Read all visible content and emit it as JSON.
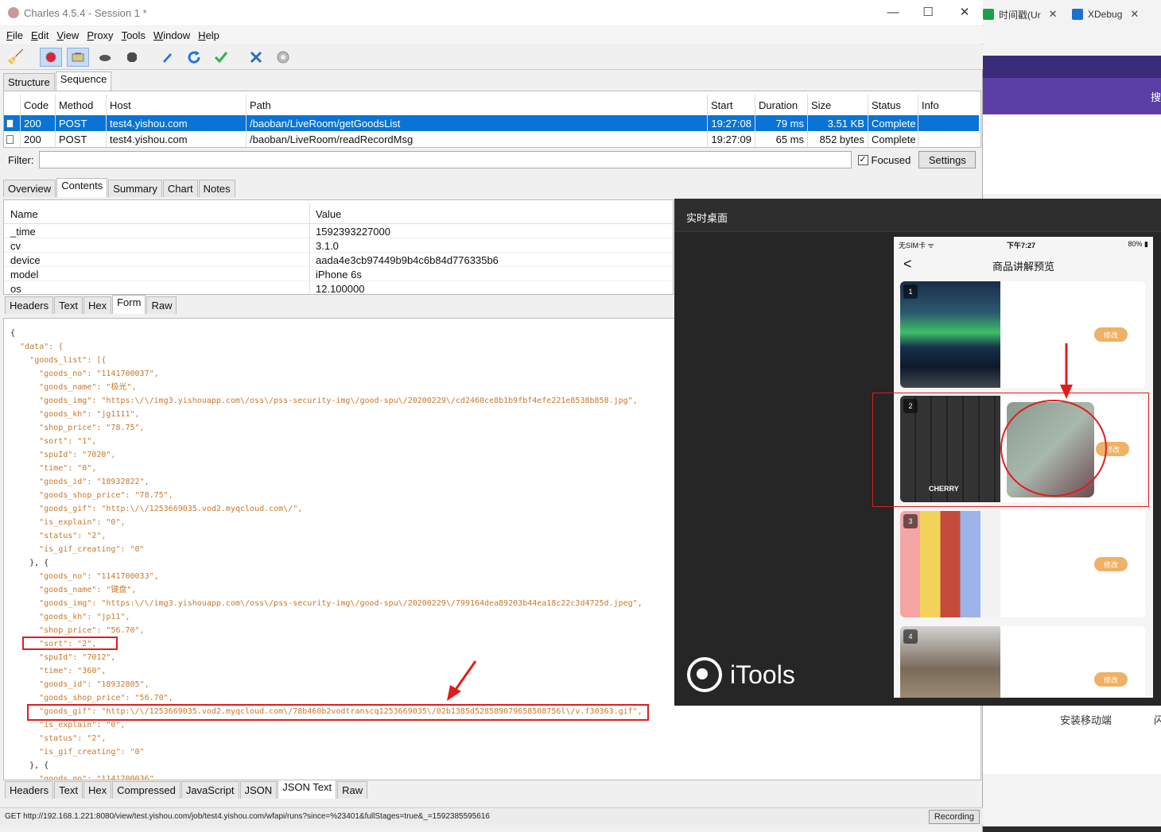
{
  "window": {
    "title": "Charles 4.5.4 - Session 1 *",
    "controls": [
      "—",
      "☐",
      "✕"
    ]
  },
  "browser_tabs": [
    {
      "label": "时间戳(Ur",
      "icon_color": "#1e9e4a"
    },
    {
      "label": "XDebug",
      "icon_color": "#1f6fd1"
    }
  ],
  "browser_bg": {
    "search_char": "搜",
    "install_label": "安装移动端",
    "more_char": "闪"
  },
  "menu": [
    "File",
    "Edit",
    "View",
    "Proxy",
    "Tools",
    "Window",
    "Help"
  ],
  "toolbar_icons": [
    "broom-icon",
    "record-icon",
    "throttle-icon",
    "turtle-icon",
    "stop-icon",
    "pen-icon",
    "refresh-icon",
    "check-icon",
    "tools-icon",
    "settings-icon"
  ],
  "top_tabs": [
    "Structure",
    "Sequence"
  ],
  "sequence": {
    "columns": [
      "Code",
      "Method",
      "Host",
      "Path",
      "Start",
      "Duration",
      "Size",
      "Status",
      "Info"
    ],
    "rows": [
      {
        "code": "200",
        "method": "POST",
        "host": "test4.yishou.com",
        "path": "/baoban/LiveRoom/getGoodsList",
        "start": "19:27:08",
        "duration": "79 ms",
        "size": "3.51 KB",
        "status": "Complete",
        "info": ""
      },
      {
        "code": "200",
        "method": "POST",
        "host": "test4.yishou.com",
        "path": "/baoban/LiveRoom/readRecordMsg",
        "start": "19:27:09",
        "duration": "65 ms",
        "size": "852 bytes",
        "status": "Complete",
        "info": ""
      }
    ]
  },
  "filter": {
    "label": "Filter:",
    "value": "",
    "focused_label": "Focused",
    "focused_checked": "✓",
    "settings_label": "Settings"
  },
  "detail_tabs": [
    "Overview",
    "Contents",
    "Summary",
    "Chart",
    "Notes"
  ],
  "form": {
    "columns": [
      "Name",
      "Value"
    ],
    "rows": [
      {
        "name": "_time",
        "value": "1592393227000"
      },
      {
        "name": "cv",
        "value": "3.1.0"
      },
      {
        "name": "device",
        "value": "aada4e3cb97449b9b4c6b84d776335b6"
      },
      {
        "name": "model",
        "value": "iPhone 6s"
      },
      {
        "name": "os",
        "value": "12.100000"
      }
    ]
  },
  "request_tabs": [
    "Headers",
    "Text",
    "Hex",
    "Form",
    "Raw"
  ],
  "json_lines": [
    "{",
    "  \"data\": {",
    "    \"goods_list\": [{",
    "      \"goods_no\": \"1141700037\",",
    "      \"goods_name\": \"极光\",",
    "      \"goods_img\": \"https:\\/\\/img3.yishouapp.com\\/oss\\/pss-security-img\\/good-spu\\/20200229\\/cd2460ce8b1b9fbf4efe221e8538b858.jpg\",",
    "      \"goods_kh\": \"jg1111\",",
    "      \"shop_price\": \"78.75\",",
    "      \"sort\": \"1\",",
    "      \"spuId\": \"7020\",",
    "      \"time\": \"0\",",
    "      \"goods_id\": \"18932822\",",
    "      \"goods_shop_price\": \"78.75\",",
    "      \"goods_gif\": \"http:\\/\\/1253669035.vod2.myqcloud.com\\/\",",
    "      \"is_explain\": \"0\",",
    "      \"status\": \"2\",",
    "      \"is_gif_creating\": \"0\"",
    "    }, {",
    "      \"goods_no\": \"1141700033\",",
    "      \"goods_name\": \"键盘\",",
    "      \"goods_img\": \"https:\\/\\/img3.yishouapp.com\\/oss\\/pss-security-img\\/good-spu\\/20200229\\/799164dea89203b44ea18c22c3d4725d.jpeg\",",
    "      \"goods_kh\": \"jp11\",",
    "      \"shop_price\": \"56.70\",",
    "      \"sort\": \"2\",",
    "      \"spuId\": \"7012\",",
    "      \"time\": \"360\",",
    "      \"goods_id\": \"18932805\",",
    "      \"goods_shop_price\": \"56.70\",",
    "      \"goods_gif\": \"http:\\/\\/1253669035.vod2.myqcloud.com\\/78b460b2vodtranscq1253669035\\/02b1385d528589079658508756l\\/v.f30363.gif\",",
    "      \"is_explain\": \"0\",",
    "      \"status\": \"2\",",
    "      \"is_gif_creating\": \"0\"",
    "    }, {",
    "      \"goods_no\": \"1141700036\","
  ],
  "response_tabs": [
    "Headers",
    "Text",
    "Hex",
    "Compressed",
    "JavaScript",
    "JSON",
    "JSON Text",
    "Raw"
  ],
  "statusbar": {
    "url": "GET http://192.168.1.221:8080/view/test.yishou.com/job/test4.yishou.com/wfapi/runs?since=%23401&fullStages=true&_=1592385595616",
    "recording": "Recording"
  },
  "itools": {
    "title": "实时桌面",
    "logo": "iTools",
    "phone": {
      "status_left": "无SIM卡 ᯤ",
      "status_time": "下午7:27",
      "status_battery": "80% ▮",
      "nav_back": "<",
      "nav_title": "商品讲解预览",
      "edit_label": "修改",
      "cards": [
        {
          "num": "1"
        },
        {
          "num": "2"
        },
        {
          "num": "3"
        },
        {
          "num": "4"
        }
      ],
      "keyboard_brand": "CHERRY"
    }
  },
  "colors": {
    "selection": "#0a74d6",
    "annotation": "#e01d1d",
    "json_key": "#c8782a"
  }
}
